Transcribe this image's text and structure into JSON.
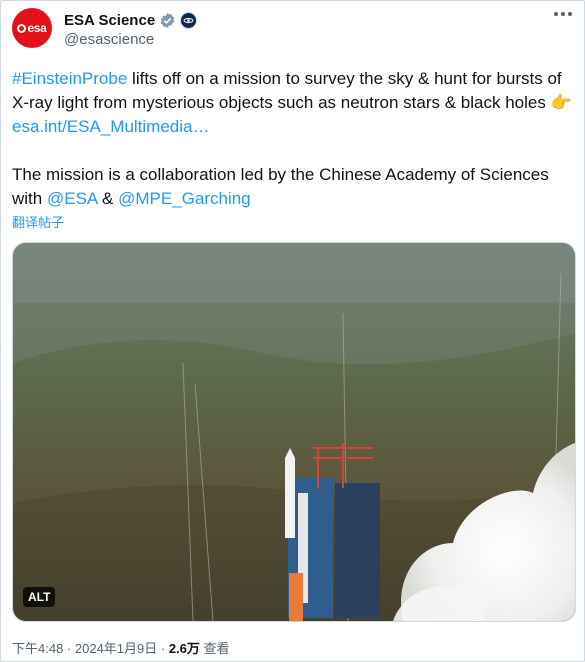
{
  "account": {
    "display_name": "ESA Science",
    "handle": "@esascience",
    "avatar_text": "esa"
  },
  "post": {
    "hashtag": "#EinsteinProbe",
    "line1_rest": " lifts off on a mission to survey the sky & hunt for bursts of X-ray light from mysterious objects such as neutron stars & black holes ",
    "emoji": "👉",
    "link_text": " esa.int/ESA_Multimedia…",
    "p2_start": "The mission is a collaboration led by the Chinese Academy of Sciences with ",
    "mention1": "@ESA",
    "amp": " & ",
    "mention2": "@MPE_Garching",
    "translate_label": "翻译帖子"
  },
  "media": {
    "alt_badge": "ALT"
  },
  "meta": {
    "time": "下午4:48",
    "sep": " · ",
    "date": "2024年1月9日",
    "sep2": " · ",
    "views": "2.6万",
    "views_label": " 查看"
  },
  "colors": {
    "link": "#1d9bf0",
    "brand_red": "#e3101b",
    "verified": "#829aab"
  }
}
